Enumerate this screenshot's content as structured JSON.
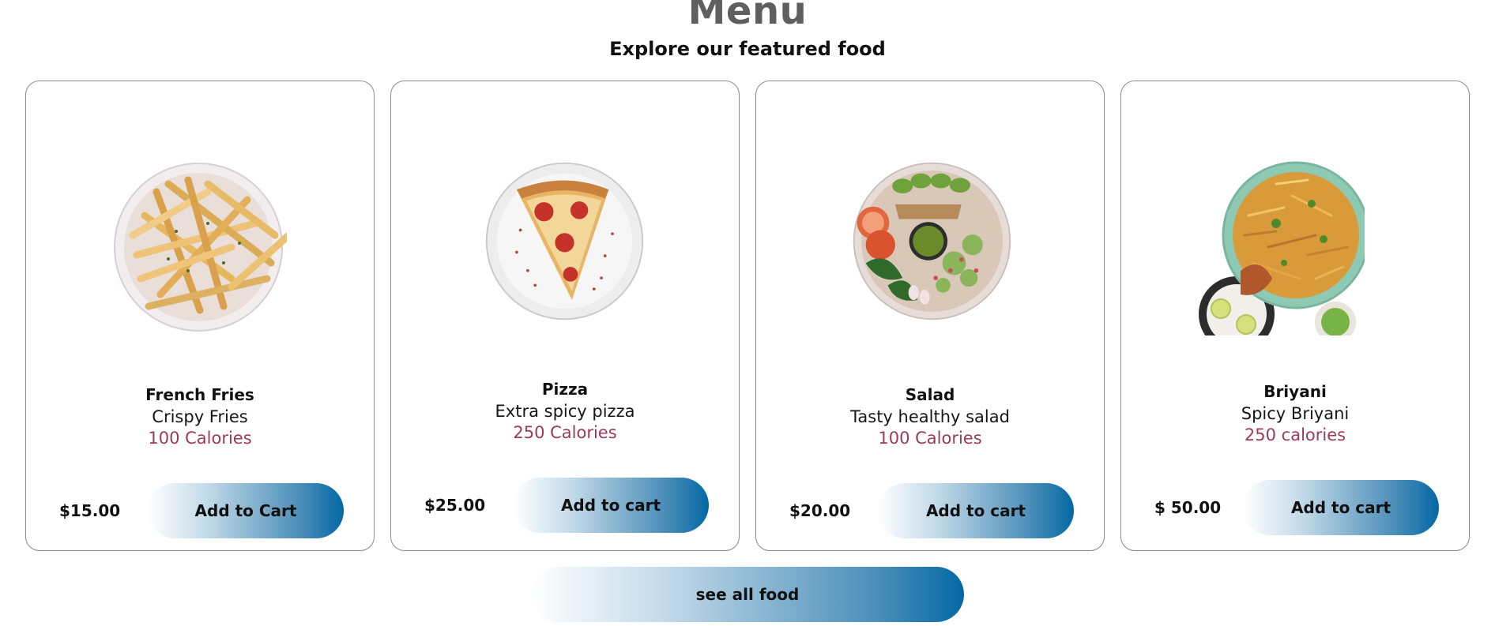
{
  "header": {
    "title": "Menu",
    "subtitle": "Explore our featured food"
  },
  "cards": [
    {
      "name": "French Fries",
      "description": "Crispy Fries",
      "calories": "100 Calories",
      "price": "$15.00",
      "button": "Add to Cart",
      "image_icon": "french-fries-image"
    },
    {
      "name": "Pizza",
      "description": "Extra spicy pizza",
      "calories": "250 Calories",
      "price": "$25.00",
      "button": "Add to cart",
      "image_icon": "pizza-image"
    },
    {
      "name": "Salad",
      "description": "Tasty healthy salad",
      "calories": "100 Calories",
      "price": "$20.00",
      "button": "Add to cart",
      "image_icon": "salad-image"
    },
    {
      "name": "Briyani",
      "description": "Spicy Briyani",
      "calories": "250 calories",
      "price": "$ 50.00",
      "button": "Add to cart",
      "image_icon": "briyani-image"
    }
  ],
  "footer": {
    "see_all_label": "see all food"
  },
  "colors": {
    "title": "#5f5f5f",
    "calories": "#9b3b57",
    "button_gradient_end": "#0468a4",
    "card_border": "#8a8a8a"
  }
}
